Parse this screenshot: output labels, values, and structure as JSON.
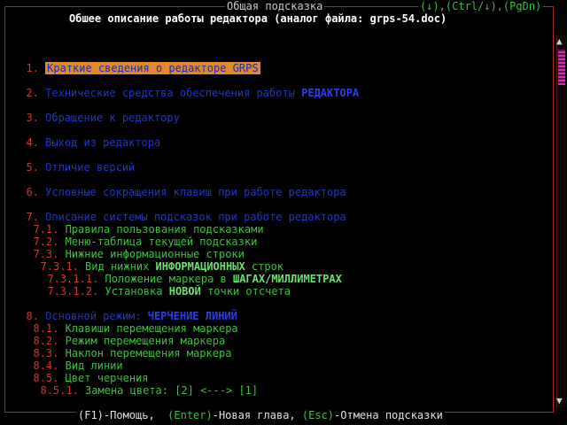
{
  "header": {
    "title": "Общая подсказка",
    "keys": "(↓),(Ctrl/↓),(PgDn)",
    "subtitle": "Обшее описание работы редактора (аналог файла: grps-54.doc)"
  },
  "items": [
    {
      "num": "1.",
      "label": "Краткие сведения о редакторе GRPS"
    },
    {
      "num": "2.",
      "label": "Технические средства обеспечения работы ",
      "label_bold": "РЕДАКТОРА"
    },
    {
      "num": "3.",
      "label": "Обращение к редактору"
    },
    {
      "num": "4.",
      "label": "Выход из редактора"
    },
    {
      "num": "5.",
      "label": "Отличие версий"
    },
    {
      "num": "6.",
      "label": "Условные сокращения клавиш при работе редактора"
    },
    {
      "num": "7.",
      "label": "Описание системы подсказок при работе редактора"
    }
  ],
  "sub7": [
    {
      "num": "7.1.",
      "label": "Правила пользования подсказками"
    },
    {
      "num": "7.2.",
      "label": "Меню-таблица текущей подсказки"
    },
    {
      "num": "7.3.",
      "label": "Нижние информационные строки"
    },
    {
      "num": "7.3.1.",
      "label": "Вид нижних ",
      "label_bold": "ИНФОРМАЦИОННЫХ",
      "label_tail": " строк"
    },
    {
      "num": "7.3.1.1.",
      "label": "Положение маркера в ",
      "label_bold": "ШАГАХ/МИЛЛИМЕТРАХ"
    },
    {
      "num": "7.3.1.2.",
      "label": "Установка ",
      "label_bold": "НОВОЙ",
      "label_tail": " точки отсчета"
    }
  ],
  "item8": {
    "num": "8.",
    "label": "Основной режим: ",
    "label_bold": "ЧЕРЧЕНИЕ ЛИНИЙ"
  },
  "sub8": [
    {
      "num": "8.1.",
      "label": "Клавиши перемещения маркера"
    },
    {
      "num": "8.2.",
      "label": "Режим перемещения маркера"
    },
    {
      "num": "8.3.",
      "label": "Наклон перемещения маркера"
    },
    {
      "num": "8.4.",
      "label": "Вид линии"
    },
    {
      "num": "8.5.",
      "label": "Цвет черчения"
    },
    {
      "num": "8.5.1.",
      "label": "Замена цвета: [2] <---> [1]"
    }
  ],
  "footer": {
    "f1_key": "(F1)",
    "f1_text": "-Помощь,",
    "enter_key": "(Enter)",
    "enter_text": "-Новая глава,",
    "esc_key": "(Esc)",
    "esc_text": "-Отмена подсказки"
  },
  "scrollbar": {
    "up_icon": "▲",
    "down_icon": "▼"
  },
  "colors": {
    "frame": "#a82a22",
    "selection": "#e0882a",
    "blue_text": "#2535b8",
    "green_text": "#3fbf3f",
    "number_red": "#c83a2c"
  }
}
